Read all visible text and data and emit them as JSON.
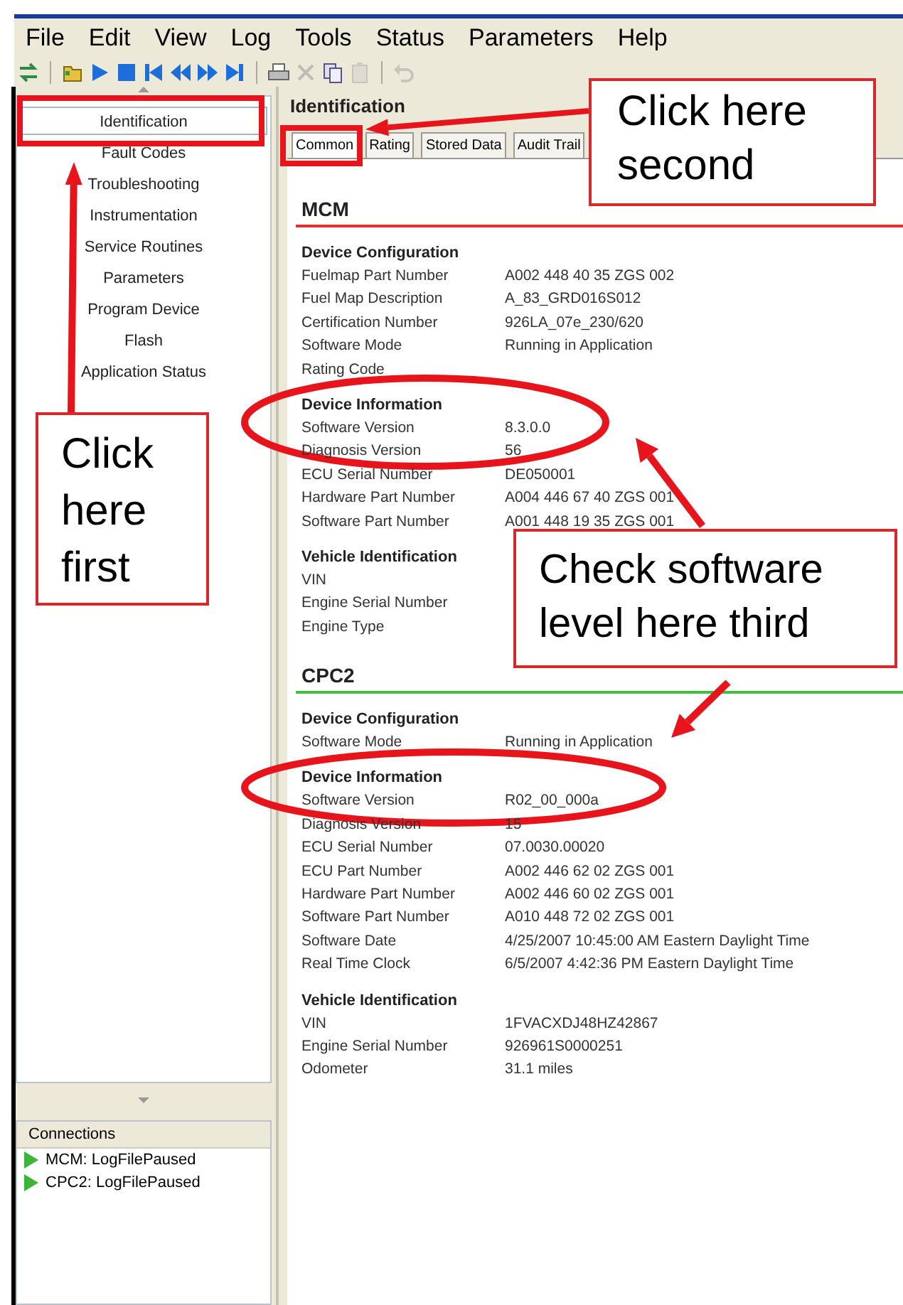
{
  "menu": [
    "File",
    "Edit",
    "View",
    "Log",
    "Tools",
    "Status",
    "Parameters",
    "Help"
  ],
  "toolbar": [
    {
      "kind": "swap",
      "disabled": false
    },
    {
      "kind": "sep"
    },
    {
      "kind": "folder",
      "disabled": false
    },
    {
      "kind": "play",
      "disabled": false
    },
    {
      "kind": "stop",
      "disabled": false
    },
    {
      "kind": "first",
      "disabled": false
    },
    {
      "kind": "rewind",
      "disabled": false
    },
    {
      "kind": "forward",
      "disabled": false
    },
    {
      "kind": "last",
      "disabled": false
    },
    {
      "kind": "sep"
    },
    {
      "kind": "print",
      "disabled": false
    },
    {
      "kind": "cut",
      "disabled": true
    },
    {
      "kind": "copy",
      "disabled": false
    },
    {
      "kind": "paste",
      "disabled": true
    },
    {
      "kind": "sep"
    },
    {
      "kind": "undo",
      "disabled": true
    }
  ],
  "sidebar": {
    "items": [
      {
        "label": "Identification",
        "selected": true
      },
      {
        "label": "Fault Codes",
        "selected": false
      },
      {
        "label": "Troubleshooting",
        "selected": false
      },
      {
        "label": "Instrumentation",
        "selected": false
      },
      {
        "label": "Service Routines",
        "selected": false
      },
      {
        "label": "Parameters",
        "selected": false
      },
      {
        "label": "Program Device",
        "selected": false
      },
      {
        "label": "Flash",
        "selected": false
      },
      {
        "label": "Application Status",
        "selected": false
      }
    ]
  },
  "connections": {
    "title": "Connections",
    "items": [
      {
        "label": "MCM: LogFilePaused",
        "color": "#3cb43c"
      },
      {
        "label": "CPC2: LogFilePaused",
        "color": "#3cb43c"
      }
    ]
  },
  "page": {
    "title": "Identification",
    "tabs": [
      {
        "label": "Common",
        "selected": true
      },
      {
        "label": "Rating",
        "selected": false
      },
      {
        "label": "Stored Data",
        "selected": false
      },
      {
        "label": "Audit Trail",
        "selected": false
      }
    ],
    "sections": [
      {
        "title": "MCM",
        "color": "#e03030",
        "groups": [
          {
            "title": "Device Configuration",
            "rows": [
              {
                "label": "Fuelmap Part Number",
                "value": "A002 448 40 35 ZGS 002"
              },
              {
                "label": "Fuel Map Description",
                "value": "A_83_GRD016S012"
              },
              {
                "label": "Certification Number",
                "value": "926LA_07e_230/620"
              },
              {
                "label": "Software Mode",
                "value": "Running in Application"
              },
              {
                "label": "Rating Code"
              }
            ]
          },
          {
            "title": "Device Information",
            "rows": [
              {
                "label": "Software Version",
                "value": "8.3.0.0"
              },
              {
                "label": "Diagnosis Version",
                "value": "56"
              },
              {
                "label": "ECU Serial Number",
                "value": "DE050001"
              },
              {
                "label": "Hardware Part Number",
                "value": "A004 446 67 40 ZGS 001"
              },
              {
                "label": "Software Part Number",
                "value": "A001 448 19 35 ZGS 001"
              }
            ]
          },
          {
            "title": "Vehicle Identification",
            "rows": [
              {
                "label": "VIN"
              },
              {
                "label": "Engine Serial Number"
              },
              {
                "label": "Engine Type"
              }
            ]
          }
        ]
      },
      {
        "title": "CPC2",
        "color": "#40c040",
        "groups": [
          {
            "title": "Device Configuration",
            "rows": [
              {
                "label": "Software Mode",
                "value": "Running in Application"
              }
            ]
          },
          {
            "title": "Device Information",
            "rows": [
              {
                "label": "Software Version",
                "value": "R02_00_000a"
              },
              {
                "label": "Diagnosis Version",
                "value": "15"
              },
              {
                "label": "ECU Serial Number",
                "value": "07.0030.00020"
              },
              {
                "label": "ECU Part Number",
                "value": "A002 446 62 02 ZGS 001"
              },
              {
                "label": "Hardware Part Number",
                "value": "A002 446 60 02 ZGS 001"
              },
              {
                "label": "Software Part Number",
                "value": "A010 448 72 02 ZGS 001"
              },
              {
                "label": "Software Date",
                "value": "4/25/2007 10:45:00 AM Eastern Daylight Time"
              },
              {
                "label": "Real Time Clock",
                "value": "6/5/2007 4:42:36 PM Eastern Daylight Time"
              }
            ]
          },
          {
            "title": "Vehicle Identification",
            "rows": [
              {
                "label": "VIN",
                "value": "1FVACXDJ48HZ42867"
              },
              {
                "label": "Engine Serial Number",
                "value": "926961S0000251"
              },
              {
                "label": "Odometer",
                "value": "31.1 miles"
              }
            ]
          }
        ]
      }
    ]
  },
  "annotations": {
    "callouts": [
      {
        "kind": "second",
        "text": "Click here second"
      },
      {
        "kind": "first",
        "text": "Click here first"
      },
      {
        "kind": "third",
        "text": "Check software level here third"
      }
    ]
  }
}
